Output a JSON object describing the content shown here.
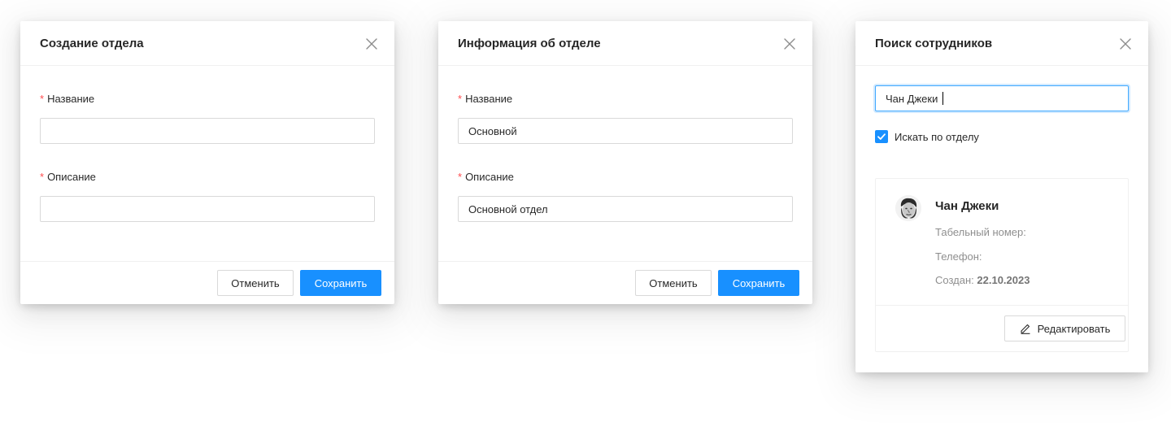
{
  "create_modal": {
    "title": "Создание отдела",
    "name_label": "Название",
    "name_value": "",
    "description_label": "Описание",
    "description_value": "",
    "cancel_label": "Отменить",
    "save_label": "Сохранить"
  },
  "info_modal": {
    "title": "Информация об отделе",
    "name_label": "Название",
    "name_value": "Основной",
    "description_label": "Описание",
    "description_value": "Основной отдел",
    "cancel_label": "Отменить",
    "save_label": "Сохранить"
  },
  "search_modal": {
    "title": "Поиск сотрудников",
    "query": "Чан Джеки",
    "checkbox_label": "Искать по отделу",
    "checkbox_checked": true,
    "employee": {
      "name": "Чан Джеки",
      "personnel_number_label": "Табельный номер:",
      "phone_label": "Телефон:",
      "created_label": "Создан:",
      "created_date": "22.10.2023"
    },
    "edit_label": "Редактировать"
  },
  "colors": {
    "primary": "#1890ff",
    "required": "#ff4d4f",
    "border": "#d9d9d9"
  }
}
